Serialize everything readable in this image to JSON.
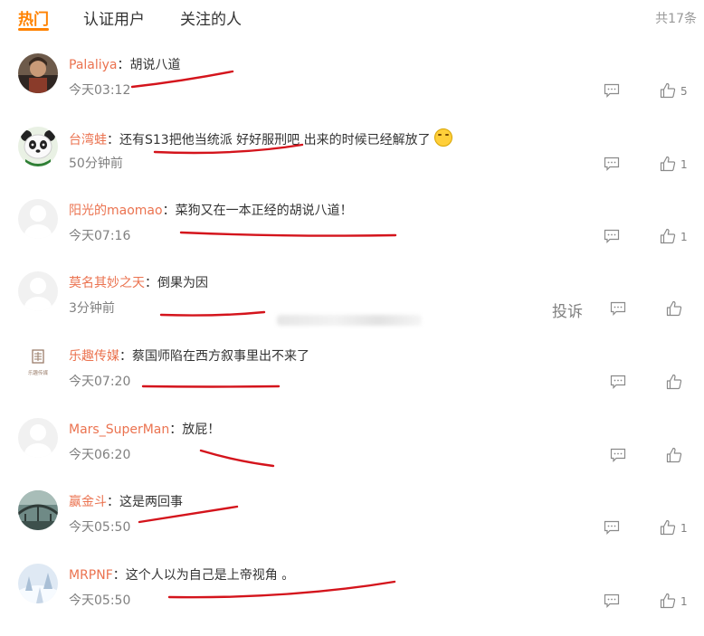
{
  "tabs": [
    "热门",
    "认证用户",
    "关注的人"
  ],
  "total": "共17条",
  "icons": {
    "reply": "comment-bubble-icon",
    "like": "thumbs-up-icon"
  },
  "colors": {
    "accent": "#ff8200",
    "username": "#eb7350",
    "annotation": "#d4141c"
  },
  "comments": [
    {
      "user": "Palaliya",
      "sep": "：",
      "text": "胡说八道",
      "time": "今天03:12",
      "likes": "5",
      "avatar": "photo-person-icon"
    },
    {
      "user": "台湾蛙",
      "sep": "：",
      "text": "还有S13把他当统派 好好服刑吧 出来的时候已经解放了",
      "time": "50分钟前",
      "likes": "1",
      "avatar": "panda-avatar-icon",
      "emoji": "laughing-crying-emoji-icon"
    },
    {
      "user": "阳光的maomao",
      "sep": "：",
      "text": "菜狗又在一本正经的胡说八道！",
      "time": "今天07:16",
      "likes": "1",
      "avatar": "default-avatar-icon"
    },
    {
      "user": "莫名其妙之天",
      "sep": "：",
      "text": "倒果为因",
      "time": "3分钟前",
      "likes": "",
      "avatar": "default-avatar-icon",
      "report": "投诉"
    },
    {
      "user": "乐趣传媒",
      "sep": "：",
      "text": "蔡国师陷在西方叙事里出不来了",
      "time": "今天07:20",
      "likes": "",
      "avatar": "logo-avatar-icon",
      "logo_text": "乐趣传媒"
    },
    {
      "user": "Mars_SuperMan",
      "sep": "：",
      "text": "放屁！",
      "time": "今天06:20",
      "likes": "",
      "avatar": "default-avatar-icon"
    },
    {
      "user": "赢金斗",
      "sep": "：",
      "text": "这是两回事",
      "time": "今天05:50",
      "likes": "1",
      "avatar": "bridge-photo-avatar-icon"
    },
    {
      "user": "MRPNF",
      "sep": "：",
      "text": "这个人以为自己是上帝视角 。",
      "time": "今天05:50",
      "likes": "1",
      "avatar": "snow-photo-avatar-icon"
    }
  ]
}
